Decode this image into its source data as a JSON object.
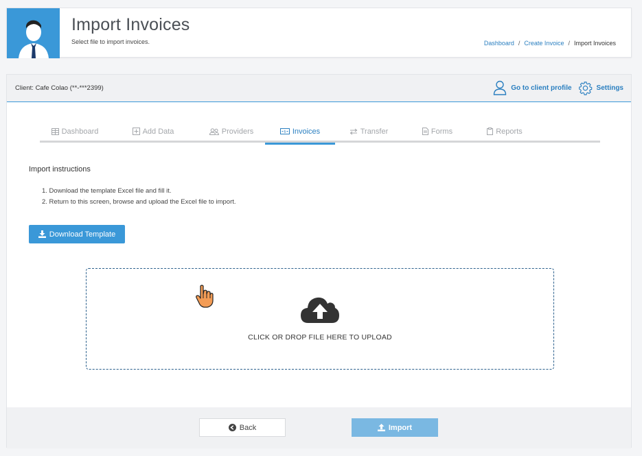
{
  "header": {
    "title": "Import Invoices",
    "subtitle": "Select file to import invoices.",
    "breadcrumb": [
      {
        "label": "Dashboard",
        "link": true
      },
      {
        "label": "Create Invoice",
        "link": true
      },
      {
        "label": "Import Invoices",
        "link": false
      }
    ],
    "separator": "/"
  },
  "client_bar": {
    "client": "Client: Cafe Colao (**-***2399)",
    "profile_label": "Go to client profile",
    "settings_label": "Settings"
  },
  "tabs": [
    {
      "label": "Dashboard",
      "icon": "table-icon",
      "active": false
    },
    {
      "label": "Add Data",
      "icon": "plus-square-icon",
      "active": false
    },
    {
      "label": "Providers",
      "icon": "users-icon",
      "active": false
    },
    {
      "label": "Invoices",
      "icon": "invoice-icon",
      "active": true
    },
    {
      "label": "Transfer",
      "icon": "exchange-icon",
      "active": false
    },
    {
      "label": "Forms",
      "icon": "file-icon",
      "active": false
    },
    {
      "label": "Reports",
      "icon": "clipboard-icon",
      "active": false
    }
  ],
  "instructions": {
    "title": "Import instructions",
    "steps": [
      "1. Download the template Excel file and fill it.",
      "2. Return to this screen, browse and upload the Excel file to import."
    ]
  },
  "download_button": "Download Template",
  "dropzone": {
    "text": "CLICK OR DROP FILE HERE TO UPLOAD"
  },
  "footer": {
    "back_label": "Back",
    "import_label": "Import"
  },
  "colors": {
    "accent": "#3a98d8",
    "link": "#2a7fc0",
    "import_disabled": "#7ab8e2"
  }
}
